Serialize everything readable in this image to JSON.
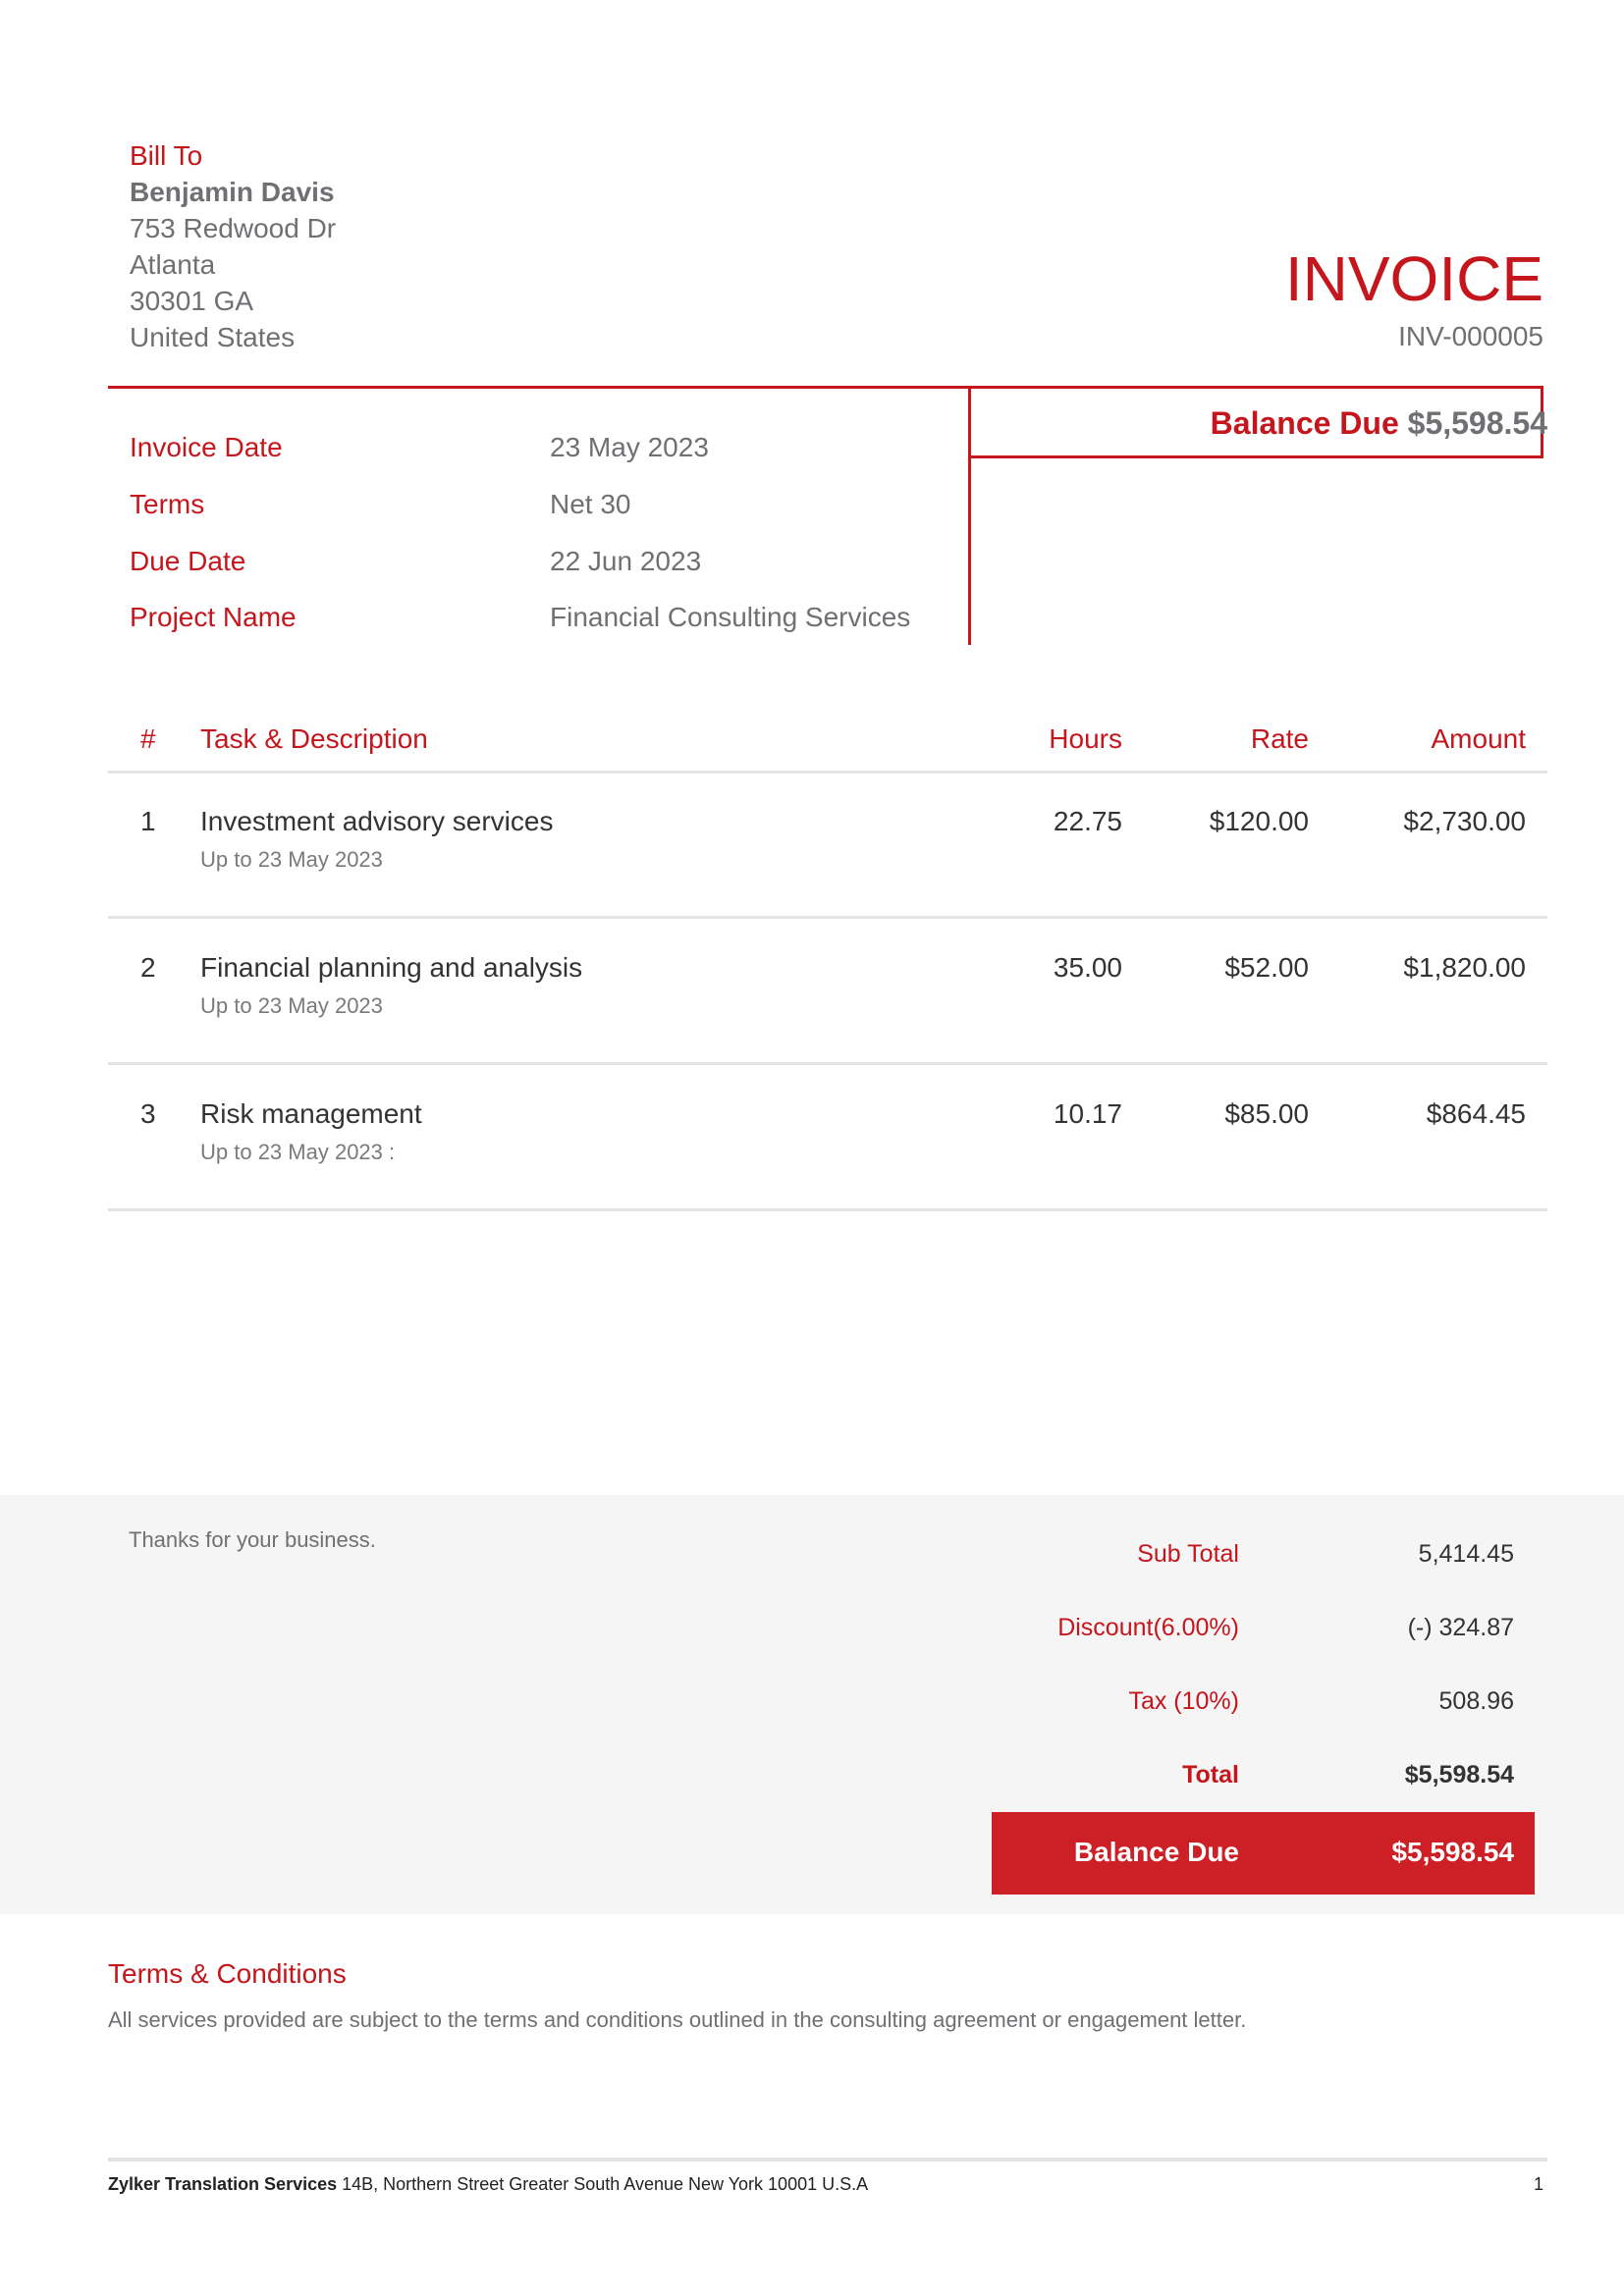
{
  "bill_to": {
    "label": "Bill To",
    "name": "Benjamin Davis",
    "address_line1": "753 Redwood Dr",
    "city": "Atlanta",
    "postal_state": "30301 GA",
    "country": "United States"
  },
  "header": {
    "title": "INVOICE",
    "invoice_number": "INV-000005"
  },
  "balance_box": {
    "label": "Balance Due",
    "amount": "$5,598.54"
  },
  "meta": [
    {
      "label": "Invoice Date",
      "value": "23 May 2023"
    },
    {
      "label": "Terms",
      "value": "Net 30"
    },
    {
      "label": "Due Date",
      "value": "22 Jun 2023"
    },
    {
      "label": "Project Name",
      "value": "Financial Consulting Services"
    }
  ],
  "table": {
    "headers": {
      "num": "#",
      "task": "Task & Description",
      "hours": "Hours",
      "rate": "Rate",
      "amount": "Amount"
    },
    "rows": [
      {
        "num": "1",
        "task": "Investment advisory services",
        "desc": "Up to 23 May 2023",
        "hours": "22.75",
        "rate": "$120.00",
        "amount": "$2,730.00"
      },
      {
        "num": "2",
        "task": "Financial planning and analysis",
        "desc": "Up to 23 May 2023",
        "hours": "35.00",
        "rate": "$52.00",
        "amount": "$1,820.00"
      },
      {
        "num": "3",
        "task": "Risk management",
        "desc": "Up to 23 May 2023 :",
        "hours": "10.17",
        "rate": "$85.00",
        "amount": "$864.45"
      }
    ]
  },
  "summary": {
    "notes": "Thanks for your business.",
    "sub_total_label": "Sub Total",
    "sub_total": "5,414.45",
    "discount_label": "Discount(6.00%)",
    "discount": "(-) 324.87",
    "tax_label": "Tax (10%)",
    "tax": "508.96",
    "total_label": "Total",
    "total": "$5,598.54",
    "balance_due_label": "Balance Due",
    "balance_due": "$5,598.54"
  },
  "terms": {
    "title": "Terms & Conditions",
    "text": "All services provided are subject to the terms and conditions outlined in the consulting agreement or engagement letter."
  },
  "footer": {
    "company": "Zylker Translation Services",
    "address": " 14B, Northern Street Greater South Avenue New York 10001 U.S.A",
    "page": "1"
  },
  "colors": {
    "accent": "#c4161c",
    "balance_bar": "#cc1f26",
    "band": "#f5f5f5",
    "text_grey": "#6f7073"
  }
}
